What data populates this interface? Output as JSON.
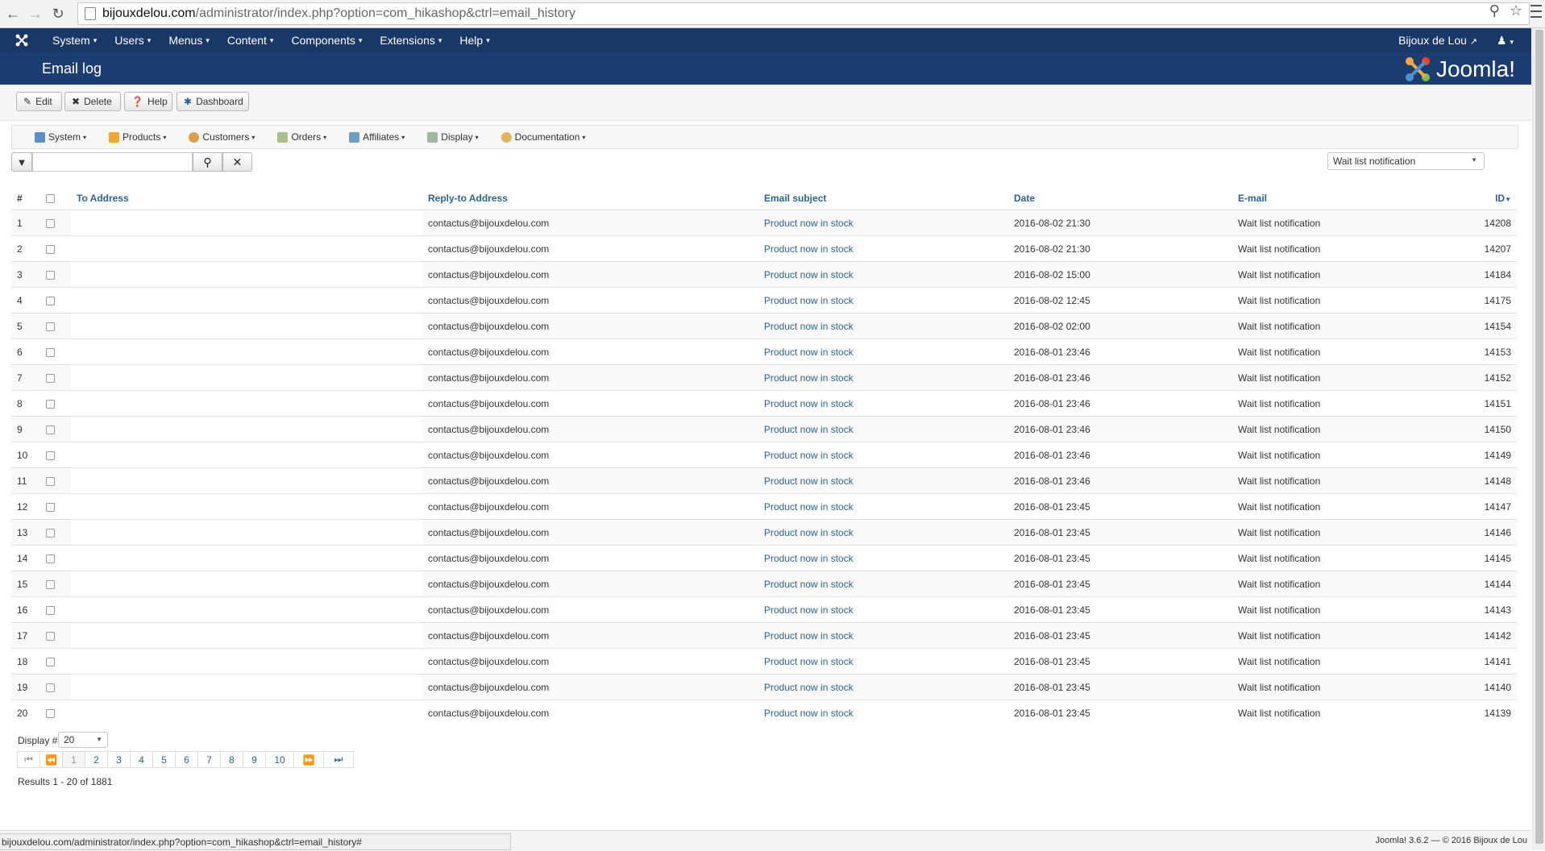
{
  "browser": {
    "url_host": "bijouxdelou.com",
    "url_path": "/administrator/index.php?option=com_hikashop&ctrl=email_history",
    "status_url": "bijouxdelou.com/administrator/index.php?option=com_hikashop&ctrl=email_history#"
  },
  "topnav": {
    "items": [
      "System",
      "Users",
      "Menus",
      "Content",
      "Components",
      "Extensions",
      "Help"
    ],
    "site_name": "Bijoux de Lou",
    "caret": "▾"
  },
  "titlebar": {
    "title": "Email log",
    "brand": "Joomla!"
  },
  "toolbar": {
    "edit": "Edit",
    "delete": "Delete",
    "help": "Help",
    "dashboard": "Dashboard"
  },
  "submenu": {
    "items": [
      "System",
      "Products",
      "Customers",
      "Orders",
      "Affiliates",
      "Display",
      "Documentation"
    ]
  },
  "filter": {
    "search_value": "",
    "type_selected": "Wait list notification"
  },
  "table": {
    "headers": {
      "num": "#",
      "to": "To Address",
      "reply": "Reply-to Address",
      "subject": "Email subject",
      "date": "Date",
      "email": "E-mail",
      "id": "ID"
    },
    "rows": [
      {
        "n": "1",
        "reply": "contactus@bijouxdelou.com",
        "subject": "Product now in stock",
        "date": "2016-08-02 21:30",
        "email": "Wait list notification",
        "id": "14208"
      },
      {
        "n": "2",
        "reply": "contactus@bijouxdelou.com",
        "subject": "Product now in stock",
        "date": "2016-08-02 21:30",
        "email": "Wait list notification",
        "id": "14207"
      },
      {
        "n": "3",
        "reply": "contactus@bijouxdelou.com",
        "subject": "Product now in stock",
        "date": "2016-08-02 15:00",
        "email": "Wait list notification",
        "id": "14184"
      },
      {
        "n": "4",
        "reply": "contactus@bijouxdelou.com",
        "subject": "Product now in stock",
        "date": "2016-08-02 12:45",
        "email": "Wait list notification",
        "id": "14175"
      },
      {
        "n": "5",
        "reply": "contactus@bijouxdelou.com",
        "subject": "Product now in stock",
        "date": "2016-08-02 02:00",
        "email": "Wait list notification",
        "id": "14154"
      },
      {
        "n": "6",
        "reply": "contactus@bijouxdelou.com",
        "subject": "Product now in stock",
        "date": "2016-08-01 23:46",
        "email": "Wait list notification",
        "id": "14153"
      },
      {
        "n": "7",
        "reply": "contactus@bijouxdelou.com",
        "subject": "Product now in stock",
        "date": "2016-08-01 23:46",
        "email": "Wait list notification",
        "id": "14152"
      },
      {
        "n": "8",
        "reply": "contactus@bijouxdelou.com",
        "subject": "Product now in stock",
        "date": "2016-08-01 23:46",
        "email": "Wait list notification",
        "id": "14151"
      },
      {
        "n": "9",
        "reply": "contactus@bijouxdelou.com",
        "subject": "Product now in stock",
        "date": "2016-08-01 23:46",
        "email": "Wait list notification",
        "id": "14150"
      },
      {
        "n": "10",
        "reply": "contactus@bijouxdelou.com",
        "subject": "Product now in stock",
        "date": "2016-08-01 23:46",
        "email": "Wait list notification",
        "id": "14149"
      },
      {
        "n": "11",
        "reply": "contactus@bijouxdelou.com",
        "subject": "Product now in stock",
        "date": "2016-08-01 23:46",
        "email": "Wait list notification",
        "id": "14148"
      },
      {
        "n": "12",
        "reply": "contactus@bijouxdelou.com",
        "subject": "Product now in stock",
        "date": "2016-08-01 23:45",
        "email": "Wait list notification",
        "id": "14147"
      },
      {
        "n": "13",
        "reply": "contactus@bijouxdelou.com",
        "subject": "Product now in stock",
        "date": "2016-08-01 23:45",
        "email": "Wait list notification",
        "id": "14146"
      },
      {
        "n": "14",
        "reply": "contactus@bijouxdelou.com",
        "subject": "Product now in stock",
        "date": "2016-08-01 23:45",
        "email": "Wait list notification",
        "id": "14145"
      },
      {
        "n": "15",
        "reply": "contactus@bijouxdelou.com",
        "subject": "Product now in stock",
        "date": "2016-08-01 23:45",
        "email": "Wait list notification",
        "id": "14144"
      },
      {
        "n": "16",
        "reply": "contactus@bijouxdelou.com",
        "subject": "Product now in stock",
        "date": "2016-08-01 23:45",
        "email": "Wait list notification",
        "id": "14143"
      },
      {
        "n": "17",
        "reply": "contactus@bijouxdelou.com",
        "subject": "Product now in stock",
        "date": "2016-08-01 23:45",
        "email": "Wait list notification",
        "id": "14142"
      },
      {
        "n": "18",
        "reply": "contactus@bijouxdelou.com",
        "subject": "Product now in stock",
        "date": "2016-08-01 23:45",
        "email": "Wait list notification",
        "id": "14141"
      },
      {
        "n": "19",
        "reply": "contactus@bijouxdelou.com",
        "subject": "Product now in stock",
        "date": "2016-08-01 23:45",
        "email": "Wait list notification",
        "id": "14140"
      },
      {
        "n": "20",
        "reply": "contactus@bijouxdelou.com",
        "subject": "Product now in stock",
        "date": "2016-08-01 23:45",
        "email": "Wait list notification",
        "id": "14139"
      }
    ]
  },
  "pagination": {
    "display_label": "Display #",
    "display_value": "20",
    "pages": [
      "1",
      "2",
      "3",
      "4",
      "5",
      "6",
      "7",
      "8",
      "9",
      "10"
    ],
    "current": "1",
    "results": "Results 1 - 20 of 1881"
  },
  "footer": {
    "copyright": "Joomla! 3.6.2  —  © 2016 Bijoux de Lou"
  },
  "colors": {
    "navbar": "#1a3867",
    "titlebar": "#1c3d72",
    "link": "#2a6496"
  }
}
